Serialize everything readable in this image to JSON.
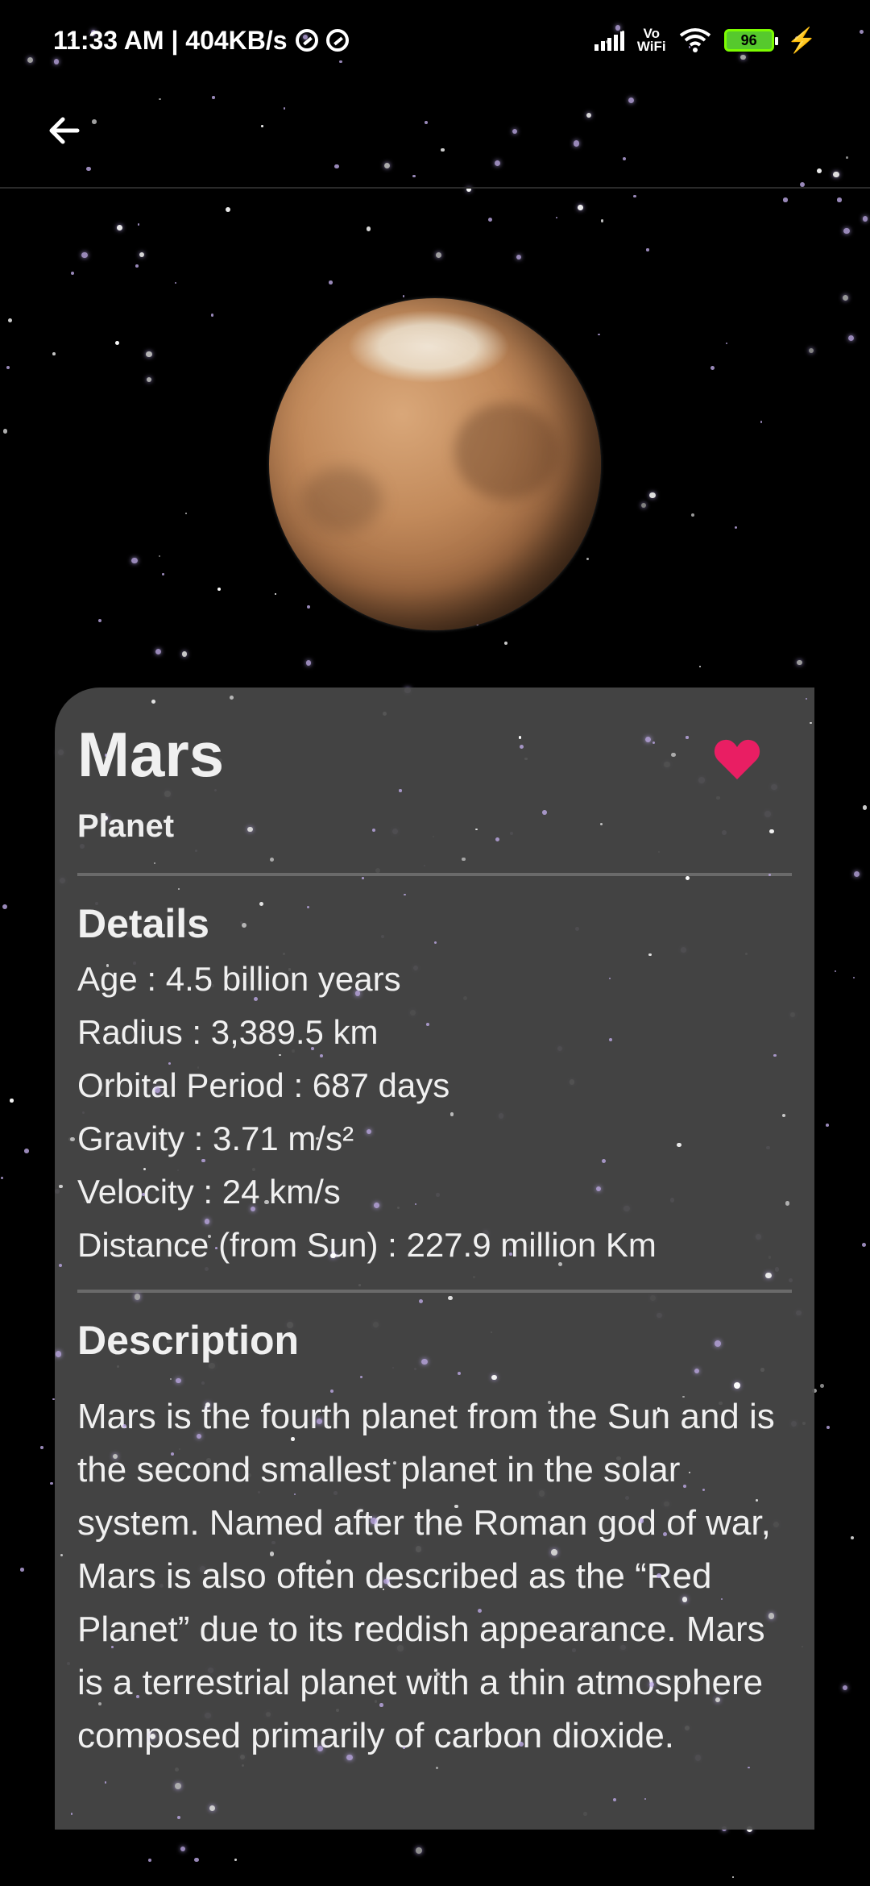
{
  "status_bar": {
    "time_speed": "11:33 AM | 404KB/s",
    "vowifi_top": "Vo",
    "vowifi_bottom": "WiFi",
    "battery": "96"
  },
  "app_bar": {
    "back_icon": "arrow-back-icon"
  },
  "planet": {
    "name": "Mars",
    "type": "Planet",
    "favorite_icon": "heart-icon",
    "favorite_color": "#e91e63"
  },
  "details": {
    "title": "Details",
    "lines": [
      "Age : 4.5 billion years",
      "Radius : 3,389.5 km",
      "Orbital Period : 687 days",
      "Gravity : 3.71 m/s²",
      "Velocity : 24 km/s",
      "Distance (from Sun) : 227.9 million Km"
    ]
  },
  "description": {
    "title": "Description",
    "text": "Mars is the fourth planet from the Sun and is the second smallest planet in the solar system. Named after the Roman god of war, Mars is also often described as the “Red Planet” due to its reddish appearance. Mars is a terrestrial planet with a thin atmosphere composed primarily of carbon dioxide."
  }
}
